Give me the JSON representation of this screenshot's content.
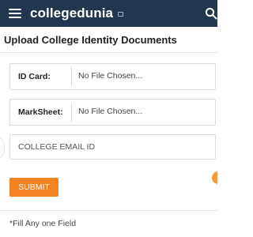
{
  "header": {
    "brand": "collegedunia",
    "background_color": "#22364f",
    "menu_icon": "hamburger-icon",
    "search_icon": "search-icon"
  },
  "form": {
    "title": "Upload College Identity Documents",
    "id_card": {
      "label": "ID Card:",
      "status": "No File Chosen..."
    },
    "marksheet": {
      "label": "MarkSheet:",
      "status": "No File Chosen..."
    },
    "email": {
      "placeholder": "COLLEGE EMAIL ID",
      "value": ""
    },
    "submit_label": "SUBMIT",
    "submit_color": "#f58220",
    "note": "*Fill Any one Field"
  }
}
